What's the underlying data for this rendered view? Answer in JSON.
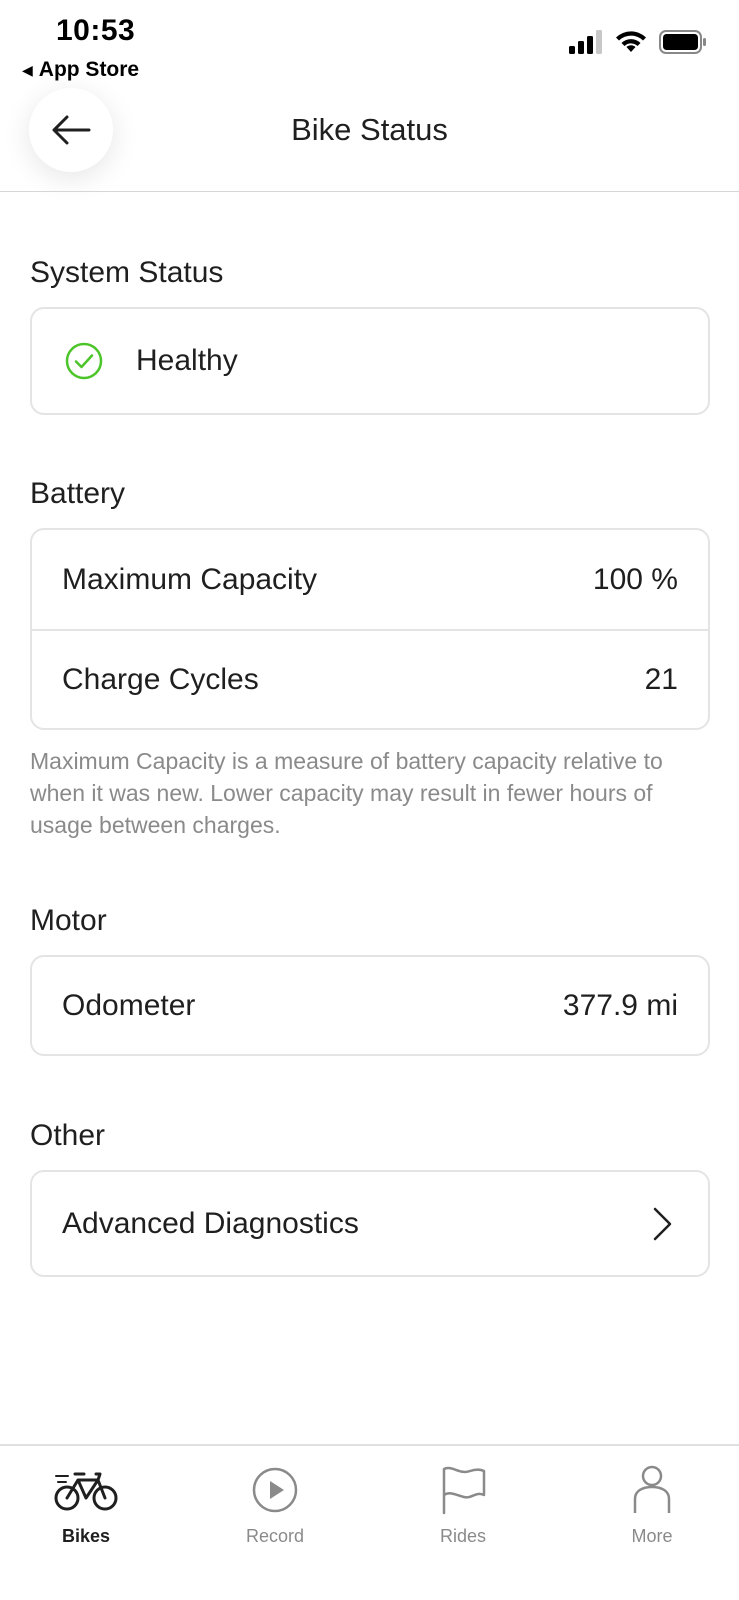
{
  "status_bar": {
    "time": "10:53",
    "back_app": "App Store"
  },
  "header": {
    "title": "Bike Status",
    "back_icon": "arrow-left-icon"
  },
  "system_status": {
    "title": "System Status",
    "value": "Healthy",
    "icon": "check-circle-icon",
    "icon_color": "#4cc52a"
  },
  "battery": {
    "title": "Battery",
    "rows": [
      {
        "label": "Maximum Capacity",
        "value": "100 %"
      },
      {
        "label": "Charge Cycles",
        "value": "21"
      }
    ],
    "note": "Maximum Capacity is a measure of battery capacity relative to when it was new. Lower capacity may result in fewer hours of usage between charges."
  },
  "motor": {
    "title": "Motor",
    "rows": [
      {
        "label": "Odometer",
        "value": "377.9 mi"
      }
    ]
  },
  "other": {
    "title": "Other",
    "rows": [
      {
        "label": "Advanced Diagnostics",
        "icon": "chevron-right-icon"
      }
    ]
  },
  "tabbar": {
    "items": [
      {
        "label": "Bikes",
        "icon": "bike-icon",
        "active": true
      },
      {
        "label": "Record",
        "icon": "play-circle-icon",
        "active": false
      },
      {
        "label": "Rides",
        "icon": "flag-icon",
        "active": false
      },
      {
        "label": "More",
        "icon": "person-icon",
        "active": false
      }
    ]
  }
}
